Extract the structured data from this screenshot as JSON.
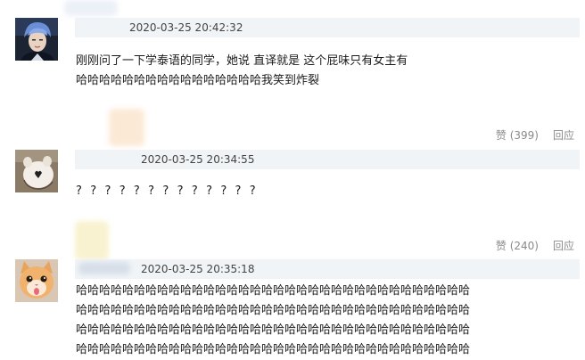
{
  "comments": [
    {
      "timestamp": "2020-03-25 20:42:32",
      "lines": [
        "刚刚问了一下学泰语的同学，她说 直译就是 这个屁味只有女主有",
        "哈哈哈哈哈哈哈哈哈哈哈哈哈哈哈哈我笑到炸裂"
      ],
      "like_label": "赞 (399)",
      "reply_label": "回应",
      "avatar_icon": "person-portrait-avatar"
    },
    {
      "timestamp": "2020-03-25 20:34:55",
      "lines": [
        "? ? ? ? ? ? ? ? ? ? ? ? ?"
      ],
      "like_label": "赞 (240)",
      "reply_label": "回应",
      "avatar_icon": "cute-bag-avatar"
    },
    {
      "timestamp": "2020-03-25 20:35:18",
      "lines": [
        "哈哈哈哈哈哈哈哈哈哈哈哈哈哈哈哈哈哈哈哈哈哈哈哈哈哈哈哈哈哈哈哈哈哈",
        "哈哈哈哈哈哈哈哈哈哈哈哈哈哈哈哈哈哈哈哈哈哈哈哈哈哈哈哈哈哈哈哈哈哈",
        "哈哈哈哈哈哈哈哈哈哈哈哈哈哈哈哈哈哈哈哈哈哈哈哈哈哈哈哈哈哈哈哈哈哈",
        "哈哈哈哈哈哈哈哈哈哈哈哈哈哈哈哈哈哈哈哈哈哈哈哈哈哈哈哈哈哈哈哈哈哈"
      ],
      "avatar_icon": "cat-avatar"
    }
  ],
  "colors": {
    "header_band": "#f0f4f7",
    "action_text": "#8a8a8a",
    "timestamp_text": "#444444"
  }
}
